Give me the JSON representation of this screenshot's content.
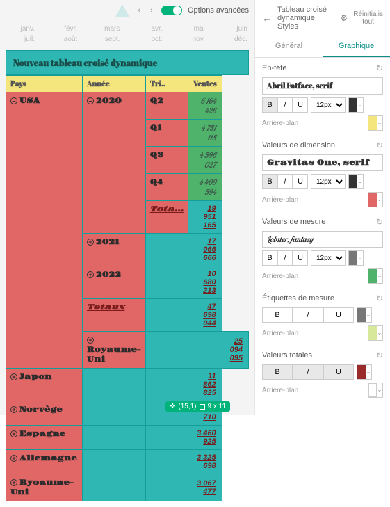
{
  "toolbar": {
    "adv_label": "Options avancées"
  },
  "months": {
    "r1": [
      "janv.",
      "févr.",
      "mars",
      "avr.",
      "mai",
      "juin"
    ],
    "r2": [
      "juil.",
      "août",
      "sept.",
      "oct.",
      "nov.",
      "déc."
    ]
  },
  "pivot": {
    "title": "Nouveau tableau croisé dynamique",
    "headers": {
      "country": "Pays",
      "year": "Année",
      "tri": "Tri..",
      "sales": "Ventes"
    },
    "rows": [
      {
        "country": "USA",
        "year": "2020",
        "quarters": [
          {
            "q": "Q2",
            "v": "6 164 426"
          },
          {
            "q": "Q1",
            "v": "4 781 118"
          },
          {
            "q": "Q3",
            "v": "4 596 027"
          },
          {
            "q": "Q4",
            "v": "4 409 594"
          }
        ],
        "year_total_label": "Tota...",
        "year_total": "19 951 165"
      }
    ],
    "years_more": [
      {
        "year": "2021",
        "v": "17 066 666"
      },
      {
        "year": "2022",
        "v": "10 680 213"
      }
    ],
    "country_total_label": "Totaux",
    "country_total": "47 698 044",
    "others": [
      {
        "c": "Royaume-Uni",
        "v": "25 094 095"
      },
      {
        "c": "Japon",
        "v": "11 862 825"
      },
      {
        "c": "Norvège",
        "v": "3 964 710"
      },
      {
        "c": "Espagne",
        "v": "3 460 925"
      },
      {
        "c": "Allemagne",
        "v": "3 325 698"
      },
      {
        "c": "Ryoaume-Uni",
        "v": "3 067 477"
      }
    ]
  },
  "coord": {
    "pos": "(15,1)",
    "size": "9 x 11"
  },
  "panel": {
    "title_l1": "Tableau croisé",
    "title_l2": "dynamique",
    "title_l3": "Styles",
    "reinit_l1": "Réinitialis",
    "reinit_l2": "tout",
    "tabs": {
      "general": "Général",
      "graph": "Graphique"
    },
    "sections": {
      "header": {
        "title": "En-tête",
        "font": "Abril Fatface, serif",
        "size": "12px",
        "bg": "#f4e67c",
        "color": "#333",
        "bg_label": "Arrière-plan"
      },
      "dim": {
        "title": "Valeurs de dimension",
        "font": "Gravitas One, serif",
        "size": "12px",
        "bg": "#e16767",
        "color": "#333",
        "bg_label": "Arrière-plan"
      },
      "meas": {
        "title": "Valeurs de mesure",
        "font": "Lobster, fantasy",
        "size": "12px",
        "bg": "#4fb36c",
        "color": "#777",
        "bg_label": "Arrière-plan"
      },
      "mlabel": {
        "title": "Étiquettes de mesure",
        "bg": "#d7e89a",
        "color": "#777",
        "bg_label": "Arrière-plan"
      },
      "totals": {
        "title": "Valeurs totales",
        "bg": "#9a2b2b",
        "color": "#9a2b2b",
        "bg_label": "Arrière-plan"
      }
    }
  }
}
